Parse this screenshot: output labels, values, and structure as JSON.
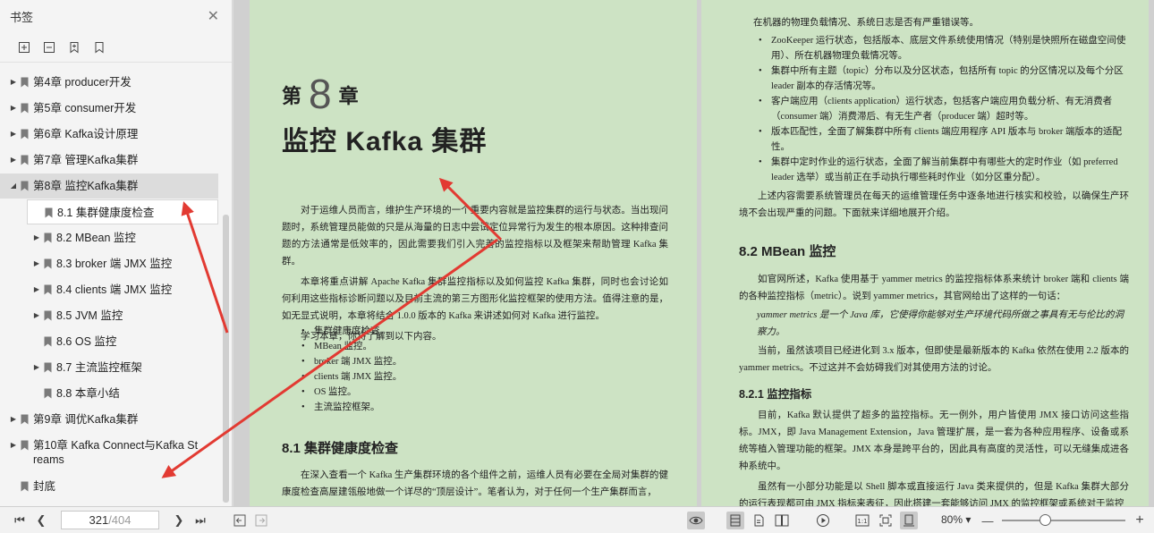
{
  "sidebar": {
    "title": "书签",
    "toc": [
      {
        "label": "第4章   producer开发",
        "level": 0,
        "expandable": true
      },
      {
        "label": "第5章   consumer开发",
        "level": 0,
        "expandable": true
      },
      {
        "label": "第6章   Kafka设计原理",
        "level": 0,
        "expandable": true
      },
      {
        "label": "第7章   管理Kafka集群",
        "level": 0,
        "expandable": true
      },
      {
        "label": "第8章   监控Kafka集群",
        "level": 0,
        "expandable": true,
        "expanded": true,
        "selected": true
      },
      {
        "label": "8.1 集群健康度检查",
        "level": 1,
        "expandable": false,
        "current": true
      },
      {
        "label": "8.2 MBean 监控",
        "level": 1,
        "expandable": true
      },
      {
        "label": "8.3 broker 端 JMX 监控",
        "level": 1,
        "expandable": true
      },
      {
        "label": "8.4 clients 端 JMX 监控",
        "level": 1,
        "expandable": true
      },
      {
        "label": "8.5 JVM 监控",
        "level": 1,
        "expandable": true
      },
      {
        "label": "8.6 OS 监控",
        "level": 1,
        "expandable": false
      },
      {
        "label": "8.7 主流监控框架",
        "level": 1,
        "expandable": true
      },
      {
        "label": "8.8 本章小结",
        "level": 1,
        "expandable": false
      },
      {
        "label": "第9章   调优Kafka集群",
        "level": 0,
        "expandable": true
      },
      {
        "label": "第10章   Kafka Connect与Kafka Streams",
        "level": 0,
        "expandable": true,
        "line1": "第10章   Kafka Connect与Kafka St",
        "line2": "reams"
      },
      {
        "label": "封底",
        "level": 0,
        "expandable": false
      }
    ]
  },
  "left_page": {
    "chapter_prefix": "第",
    "chapter_number": "8",
    "chapter_suffix": "章",
    "chapter_title": "监控 Kafka 集群",
    "intro_p1": "对于运维人员而言，维护生产环境的一个重要内容就是监控集群的运行与状态。当出现问题时，系统管理员能做的只是从海量的日志中尝试定位异常行为发生的根本原因。这种排查问题的方法通常是低效率的，因此需要我们引入完善的监控指标以及框架来帮助管理 Kafka 集群。",
    "intro_p2": "本章将重点讲解 Apache Kafka 集群监控指标以及如何监控 Kafka 集群，同时也会讨论如何利用这些指标诊断问题以及目前主流的第三方图形化监控框架的使用方法。值得注意的是，如无显式说明，本章将结合 1.0.0 版本的 Kafka 来讲述如何对 Kafka 进行监控。",
    "intro_p3": "学习本章，你将了解到以下内容。",
    "bullets": [
      "集群健康度检查。",
      "MBean 监控。",
      "broker 端 JMX 监控。",
      "clients 端 JMX 监控。",
      "OS 监控。",
      "主流监控框架。"
    ],
    "section_heading": "8.1   集群健康度检查",
    "section_p1": "在深入查看一个 Kafka 生产集群环境的各个组件之前，运维人员有必要在全局对集群的健康度检查高屋建瓴般地做一个详尽的“顶层设计”。笔者认为，对于任何一个生产集群而言，"
  },
  "right_page": {
    "top_line": "在机器的物理负载情况、系统日志是否有严重错误等。",
    "bullets": [
      "ZooKeeper 运行状态，包括版本、底层文件系统使用情况（特别是快照所在磁盘空间使用）、所在机器物理负载情况等。",
      "集群中所有主题（topic）分布以及分区状态，包括所有 topic 的分区情况以及每个分区 leader 副本的存活情况等。",
      "客户端应用（clients application）运行状态，包括客户端应用负载分析、有无消费者（consumer 端）消费滞后、有无生产者（producer 端）超时等。",
      "版本匹配性，全面了解集群中所有 clients 端应用程序 API 版本与 broker 端版本的适配性。",
      "集群中定时作业的运行状态，全面了解当前集群中有哪些大的定时作业（如 preferred leader 选举）或当前正在手动执行哪些耗时作业（如分区重分配）。"
    ],
    "para_after": "上述内容需要系统管理员在每天的运维管理任务中逐条地进行核实和校验，以确保生产环境不会出现严重的问题。下面就来详细地展开介绍。",
    "sec_heading": "8.2   MBean 监控",
    "sec_p1": "如官网所述，Kafka 使用基于 yammer metrics 的监控指标体系来统计 broker 端和 clients 端的各种监控指标（metric）。说到 yammer metrics，其官网给出了这样的一句话：",
    "quote": "yammer metrics 是一个 Java 库，它使得你能够对生产环境代码所做之事具有无与伦比的洞察力。",
    "sec_p2": "当前，虽然该项目已经进化到 3.x 版本，但即使是最新版本的 Kafka 依然在使用 2.2 版本的 yammer metrics。不过这并不会妨碍我们对其使用方法的讨论。",
    "subsec_heading": "8.2.1   监控指标",
    "subsec_p1": "目前，Kafka 默认提供了超多的监控指标。无一例外，用户皆使用 JMX 接口访问这些指标。JMX，即 Java Management Extension，Java 管理扩展，是一套为各种应用程序、设备或系统等植入管理功能的框架。JMX 本身是跨平台的，因此具有高度的灵活性，可以无缝集成进各种系统中。",
    "subsec_p2": "虽然有一小部分功能是以 Shell 脚本或直接运行 Java 类来提供的，但是 Kafka 集群大部分的运行表现都可由 JMX 指标来表征，因此搭建一套能够访问 JMX 的监控框架或系统对于监控"
  },
  "bottombar": {
    "current_page": "321",
    "total_pages": "/404",
    "zoom": "80%",
    "zoom_level": 0.35
  },
  "colors": {
    "page_bg": "#cde3c4",
    "annotation_red": "#e23a32"
  }
}
